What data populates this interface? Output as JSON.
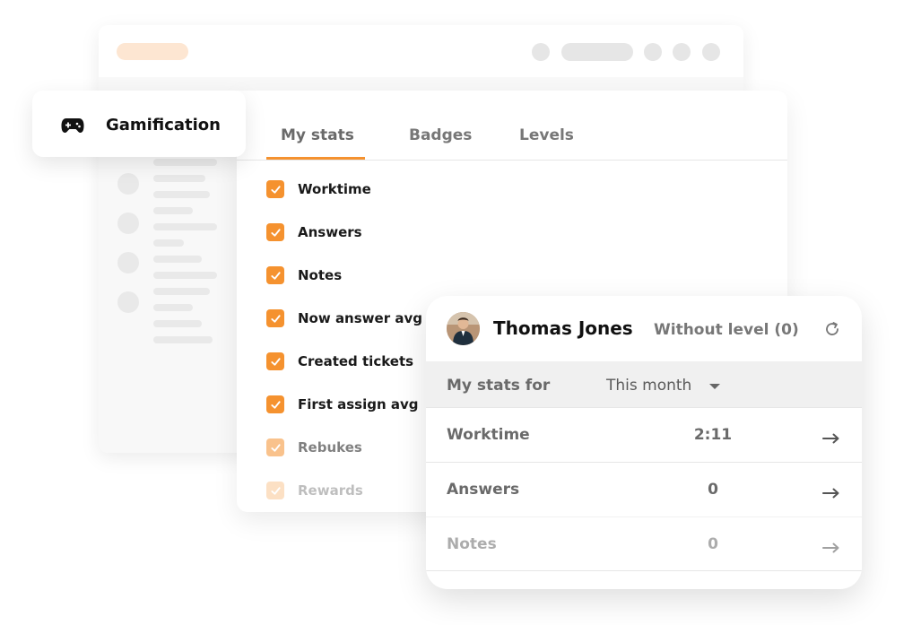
{
  "gamification": {
    "title": "Gamification",
    "icon": "gamepad-icon"
  },
  "tabs": [
    {
      "label": "My stats",
      "active": true
    },
    {
      "label": "Badges",
      "active": false
    },
    {
      "label": "Levels",
      "active": false
    }
  ],
  "stat_options": [
    {
      "label": "Worktime",
      "checked": true
    },
    {
      "label": "Answers",
      "checked": true
    },
    {
      "label": "Notes",
      "checked": true
    },
    {
      "label": "Now answer avg t",
      "checked": true
    },
    {
      "label": "Created tickets",
      "checked": true
    },
    {
      "label": "First assign avg",
      "checked": true
    },
    {
      "label": "Rebukes",
      "checked": true
    },
    {
      "label": "Rewards",
      "checked": true
    }
  ],
  "profile": {
    "name": "Thomas Jones",
    "level": "Without level (0)",
    "refresh_icon": "refresh-icon",
    "filter_label": "My stats for",
    "period": "This month",
    "rows": [
      {
        "label": "Worktime",
        "value": "2:11"
      },
      {
        "label": "Answers",
        "value": "0"
      },
      {
        "label": "Notes",
        "value": "0"
      }
    ]
  },
  "colors": {
    "accent": "#f5922f",
    "text_dark": "#111111",
    "text_muted": "#6a6a6a",
    "panel_bg": "#ffffff",
    "filter_bg": "#f0f0f0"
  }
}
